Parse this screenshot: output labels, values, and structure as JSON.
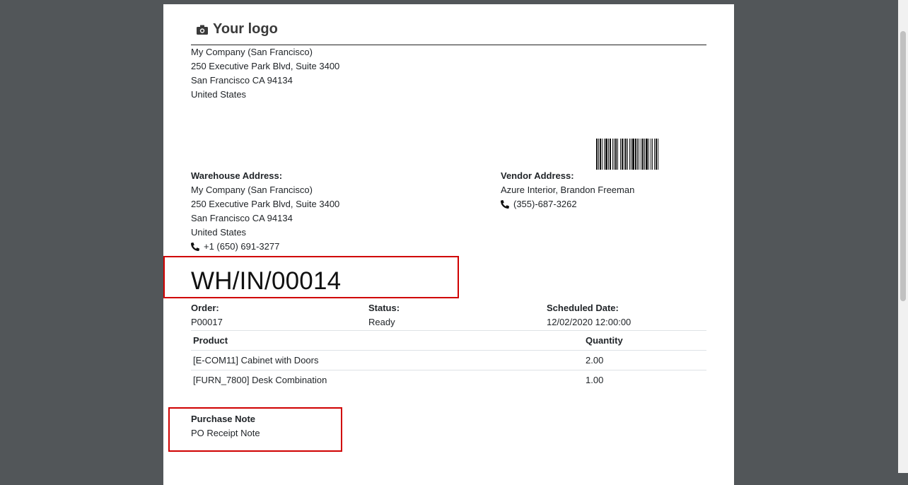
{
  "logo": {
    "text": "Your logo"
  },
  "company": {
    "name": "My Company (San Francisco)",
    "street": "250 Executive Park Blvd, Suite 3400",
    "city": "San Francisco CA 94134",
    "country": "United States"
  },
  "warehouse": {
    "label": "Warehouse Address:",
    "name": "My Company (San Francisco)",
    "street": "250 Executive Park Blvd, Suite 3400",
    "city": "San Francisco CA 94134",
    "country": "United States",
    "phone": "+1 (650) 691-3277"
  },
  "vendor": {
    "label": "Vendor Address:",
    "name": "Azure Interior, Brandon Freeman",
    "phone": "(355)-687-3262"
  },
  "reference": "WH/IN/00014",
  "meta": {
    "order_label": "Order:",
    "order_value": "P00017",
    "status_label": "Status:",
    "status_value": "Ready",
    "date_label": "Scheduled Date:",
    "date_value": "12/02/2020 12:00:00"
  },
  "table": {
    "headers": [
      "Product",
      "Quantity"
    ],
    "rows": [
      {
        "product": "[E-COM11] Cabinet with Doors",
        "quantity": "2.00"
      },
      {
        "product": "[FURN_7800] Desk Combination",
        "quantity": "1.00"
      }
    ]
  },
  "note": {
    "label": "Purchase Note",
    "text": "PO Receipt Note"
  },
  "colors": {
    "viewer_background": "#525659",
    "highlight": "#d00000"
  }
}
